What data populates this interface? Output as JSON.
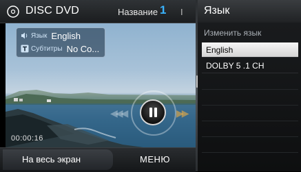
{
  "header": {
    "app_title": "DISC DVD",
    "title_label": "Название",
    "title_number": "1",
    "title_cut_text": "I"
  },
  "info": {
    "audio_label": "Язык",
    "audio_value": "English",
    "subtitle_label": "Субтитры",
    "subtitle_value": "No Co..."
  },
  "playback": {
    "timecode": "00:00:16",
    "state": "playing"
  },
  "bottom": {
    "fullscreen_label": "На весь экран",
    "menu_label": "МЕНЮ"
  },
  "panel": {
    "title": "Язык",
    "subtitle": "Изменить язык",
    "options": [
      {
        "label": "English",
        "selected": true
      },
      {
        "label": "DOLBY 5 .1 CH",
        "selected": false
      }
    ]
  },
  "icons": {
    "disc": "disc-icon",
    "speaker": "speaker-icon",
    "subtitle": "subtitle-icon",
    "pause": "pause-icon",
    "rewind": "rewind-icon",
    "fast_forward": "fast-forward-icon"
  },
  "colors": {
    "accent": "#3ab4ff",
    "selection": "#e6e6e6"
  }
}
